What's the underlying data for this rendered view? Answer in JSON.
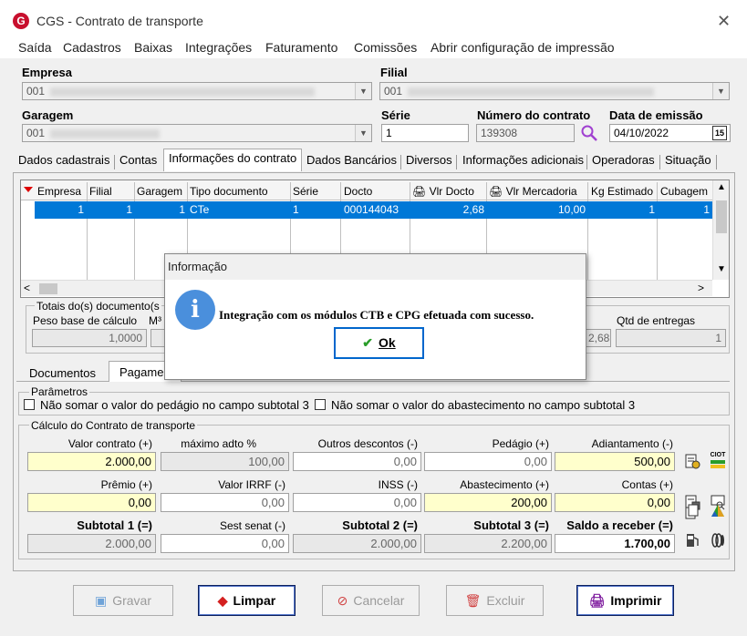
{
  "window": {
    "title": "CGS - Contrato de transporte",
    "logo": "G",
    "close": "✕"
  },
  "menu": [
    "Saída",
    "Cadastros",
    "Baixas",
    "Integrações",
    "Faturamento",
    "Comissões",
    "Abrir configuração de impressão"
  ],
  "header": {
    "empresa_label": "Empresa",
    "empresa_value": "001",
    "filial_label": "Filial",
    "filial_value": "001",
    "garagem_label": "Garagem",
    "garagem_value": "001",
    "serie_label": "Série",
    "serie_value": "1",
    "numero_label": "Número do contrato",
    "numero_value": "139308",
    "data_label": "Data de emissão",
    "data_value": "04/10/2022",
    "calendar_icon": "15"
  },
  "tabs": [
    "Dados cadastrais",
    "Contas",
    "Informações do contrato",
    "Dados Bancários",
    "Diversos",
    "Informações adicionais",
    "Operadoras",
    "Situação"
  ],
  "grid": {
    "columns": [
      "Empresa",
      "Filial",
      "Garagem",
      "Tipo documento",
      "Série",
      "Docto",
      "Vlr Docto",
      "Vlr Mercadoria",
      "Kg Estimado",
      "Cubagem"
    ],
    "row": [
      "1",
      "1",
      "1",
      "CTe",
      "1",
      "000144043",
      "2,68",
      "10,00",
      "1",
      "1"
    ]
  },
  "totals": {
    "group_title": "Totais do(s) documento(s",
    "peso_label": "Peso base de cálculo",
    "m3_label": "M³",
    "peso_value": "1,0000",
    "vlr_value": "2,68",
    "qtd_label": "Qtd de entregas",
    "qtd_value": "1"
  },
  "subtabs": [
    "Documentos",
    "Pagamen"
  ],
  "parametros": {
    "title": "Parâmetros",
    "check1": "Não somar o valor do pedágio no campo subtotal 3",
    "check2": "Não somar o valor do abastecimento no campo subtotal 3"
  },
  "calculo": {
    "title": "Cálculo do Contrato de transporte",
    "valor_contrato_label": "Valor contrato (+)",
    "valor_contrato": "2.000,00",
    "max_adto_label": "máximo adto %",
    "max_adto": "100,00",
    "outros_label": "Outros descontos (-)",
    "outros": "0,00",
    "pedagio_label": "Pedágio (+)",
    "pedagio": "0,00",
    "adiantamento_label": "Adiantamento (-)",
    "adiantamento": "500,00",
    "premio_label": "Prêmio (+)",
    "premio": "0,00",
    "irrf_label": "Valor IRRF (-)",
    "irrf": "0,00",
    "inss_label": "INSS (-)",
    "inss": "0,00",
    "abastecimento_label": "Abastecimento (+)",
    "abastecimento": "200,00",
    "contas_label": "Contas (+)",
    "contas": "0,00",
    "sub1_label": "Subtotal 1 (=)",
    "sub1": "2.000,00",
    "sest_label": "Sest senat (-)",
    "sest": "0,00",
    "sub2_label": "Subtotal 2 (=)",
    "sub2": "2.000,00",
    "sub3_label": "Subtotal 3 (=)",
    "sub3": "2.200,00",
    "saldo_label": "Saldo a receber (=)",
    "saldo": "1.700,00",
    "ciot_label": "CIOT"
  },
  "buttons": {
    "gravar": "Gravar",
    "limpar": "Limpar",
    "cancelar": "Cancelar",
    "excluir": "Excluir",
    "imprimir": "Imprimir"
  },
  "dialog": {
    "title": "Informação",
    "icon": "i",
    "message": "Integração com os módulos CTB e CPG efetuada com sucesso.",
    "ok": "Ok"
  }
}
